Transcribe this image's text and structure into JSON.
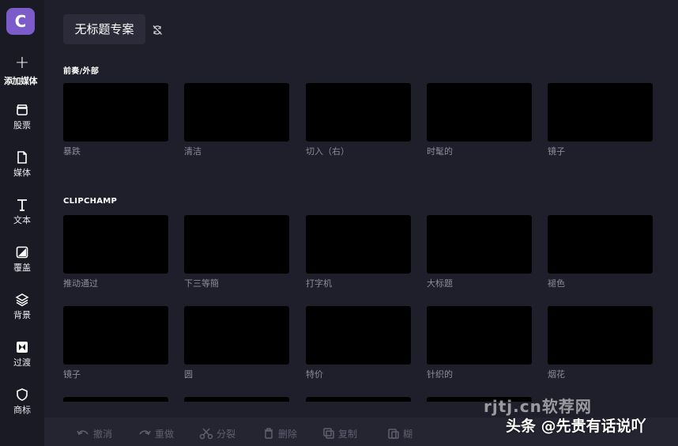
{
  "app": {
    "logo_letter": "C"
  },
  "sidebar": {
    "add_media": "添加媒体",
    "items": [
      {
        "label": "股票",
        "icon": "stock-icon"
      },
      {
        "label": "媒体",
        "icon": "file-icon"
      },
      {
        "label": "文本",
        "icon": "text-icon"
      },
      {
        "label": "覆盖",
        "icon": "overlay-icon"
      },
      {
        "label": "背景",
        "icon": "layers-icon"
      },
      {
        "label": "过渡",
        "icon": "transition-icon"
      },
      {
        "label": "商标",
        "icon": "shield-icon"
      }
    ]
  },
  "header": {
    "project_title": "无标题专案"
  },
  "sections": [
    {
      "label": "前奏/外部",
      "rows": [
        [
          "暴跌",
          "清洁",
          "切入（右）",
          "时髦的",
          "镜子"
        ]
      ]
    },
    {
      "label": "CLIPCHAMP",
      "rows": [
        [
          "推动通过",
          "下三等簡",
          "打字机",
          "大标题",
          "褪色"
        ],
        [
          "镜子",
          "圆",
          "特价",
          "针织的",
          "烟花"
        ]
      ]
    }
  ],
  "toolbar": {
    "undo": "撤消",
    "redo": "重做",
    "split": "分裂",
    "delete": "删除",
    "copy": "复制",
    "paste": "糊"
  },
  "watermark": {
    "top": "rjtj.cn软荐网",
    "main": "头条 @先贵有话说吖"
  }
}
